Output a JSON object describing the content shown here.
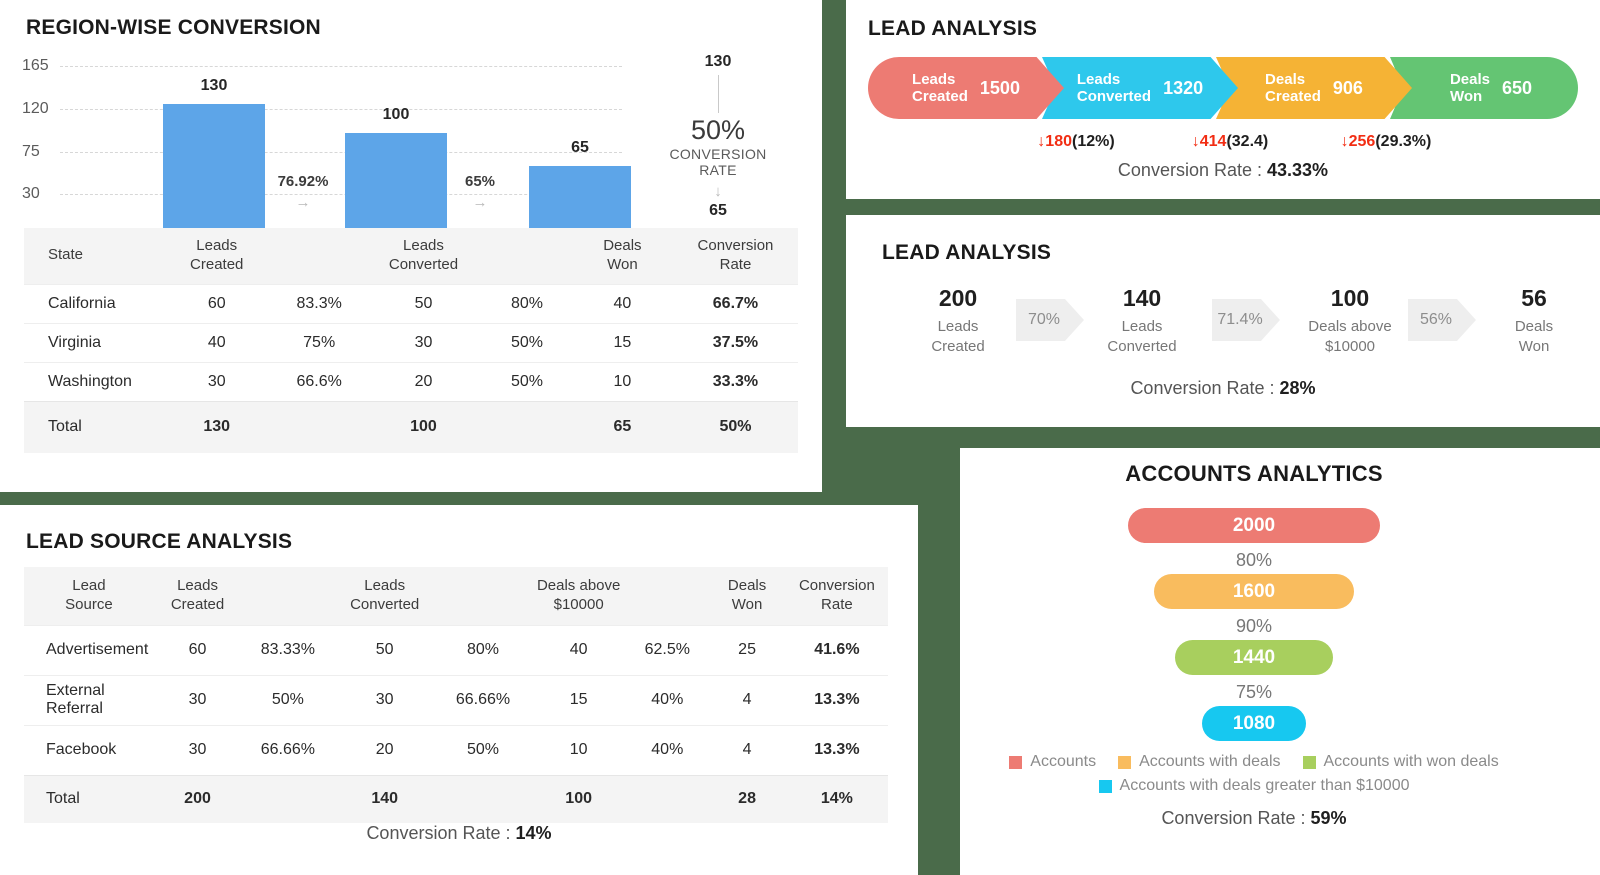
{
  "region_panel": {
    "title": "REGION-WISE CONVERSION",
    "conversion_annotation": {
      "top_value": "130",
      "rate": "50%",
      "rate_label": "CONVERSION RATE",
      "bottom_value": "65"
    },
    "table": {
      "headers": [
        "State",
        "Leads Created",
        "Leads Converted",
        "Deals Won",
        "Conversion Rate"
      ],
      "rows": [
        {
          "state": "California",
          "leads_created": "60",
          "pct1": "83.3%",
          "leads_converted": "50",
          "pct2": "80%",
          "deals_won": "40",
          "conversion_rate": "66.7%"
        },
        {
          "state": "Virginia",
          "leads_created": "40",
          "pct1": "75%",
          "leads_converted": "30",
          "pct2": "50%",
          "deals_won": "15",
          "conversion_rate": "37.5%"
        },
        {
          "state": "Washington",
          "leads_created": "30",
          "pct1": "66.6%",
          "leads_converted": "20",
          "pct2": "50%",
          "deals_won": "10",
          "conversion_rate": "33.3%"
        }
      ],
      "total": {
        "state": "Total",
        "leads_created": "130",
        "pct1": "",
        "leads_converted": "100",
        "pct2": "",
        "deals_won": "65",
        "conversion_rate": "50%"
      }
    }
  },
  "lead_analysis_1": {
    "title": "LEAD ANALYSIS",
    "stages": [
      {
        "label": "Leads\nCreated",
        "value": "1500",
        "color": "#ed7b73"
      },
      {
        "label": "Leads\nConverted",
        "value": "1320",
        "color": "#2ec8ec"
      },
      {
        "label": "Deals\nCreated",
        "value": "906",
        "color": "#f5b335"
      },
      {
        "label": "Deals\nWon",
        "value": "650",
        "color": "#64c573"
      }
    ],
    "drops": [
      {
        "arrow": "↓",
        "amount": "180",
        "pct": "(12%)"
      },
      {
        "arrow": "↓",
        "amount": "414",
        "pct": "(32.4)"
      },
      {
        "arrow": "↓",
        "amount": "256",
        "pct": "(29.3%)"
      }
    ],
    "conversion_label": "Conversion Rate : ",
    "conversion_value": "43.33%"
  },
  "lead_analysis_2": {
    "title": "LEAD ANALYSIS",
    "nodes": [
      {
        "value": "200",
        "label": "Leads\nCreated"
      },
      {
        "value": "140",
        "label": "Leads\nConverted"
      },
      {
        "value": "100",
        "label": "Deals above\n$10000"
      },
      {
        "value": "56",
        "label": "Deals\nWon"
      }
    ],
    "connectors": [
      "70%",
      "71.4%",
      "56%"
    ],
    "conversion_label": "Conversion Rate : ",
    "conversion_value": "28%"
  },
  "lead_source_panel": {
    "title": "LEAD SOURCE ANALYSIS",
    "table": {
      "headers": [
        "Lead Source",
        "Leads Created",
        "Leads Converted",
        "Deals above $10000",
        "Deals Won",
        "Conversion Rate"
      ],
      "rows": [
        {
          "source": "Advertisement",
          "leads_created": "60",
          "pct1": "83.33%",
          "leads_converted": "50",
          "pct2": "80%",
          "deals_above": "40",
          "pct3": "62.5%",
          "deals_won": "25",
          "conversion_rate": "41.6%"
        },
        {
          "source": "External Referral",
          "leads_created": "30",
          "pct1": "50%",
          "leads_converted": "30",
          "pct2": "66.66%",
          "deals_above": "15",
          "pct3": "40%",
          "deals_won": "4",
          "conversion_rate": "13.3%"
        },
        {
          "source": "Facebook",
          "leads_created": "30",
          "pct1": "66.66%",
          "leads_converted": "20",
          "pct2": "50%",
          "deals_above": "10",
          "pct3": "40%",
          "deals_won": "4",
          "conversion_rate": "13.3%"
        }
      ],
      "total": {
        "source": "Total",
        "leads_created": "200",
        "pct1": "",
        "leads_converted": "140",
        "pct2": "",
        "deals_above": "100",
        "pct3": "",
        "deals_won": "28",
        "conversion_rate": "14%"
      }
    },
    "conversion_label": "Conversion Rate : ",
    "conversion_value": "14%"
  },
  "accounts_panel": {
    "title": "ACCOUNTS ANALYTICS",
    "legend": [
      {
        "label": "Accounts",
        "color": "#ed7b73"
      },
      {
        "label": "Accounts with deals",
        "color": "#f9bc5e"
      },
      {
        "label": "Accounts with won deals",
        "color": "#a8cf5e"
      },
      {
        "label": "Accounts with deals greater than $10000",
        "color": "#17c8f0"
      }
    ],
    "conversion_label": "Conversion Rate : ",
    "conversion_value": "59%"
  },
  "chart_data": [
    {
      "type": "bar",
      "title": "REGION-WISE CONVERSION",
      "categories": [
        "Leads Created",
        "Leads Converted",
        "Deals Won"
      ],
      "values": [
        130,
        100,
        65
      ],
      "data_labels": [
        "130",
        "100",
        "65"
      ],
      "step_percentages": [
        "76.92%",
        "65%"
      ],
      "ytick_labels": [
        "30",
        "75",
        "120",
        "165"
      ],
      "ytick_values": [
        30,
        75,
        120,
        165
      ],
      "ylim": [
        0,
        165
      ],
      "grid": true,
      "legend": "none",
      "xlabel": "",
      "ylabel": ""
    },
    {
      "type": "bar",
      "title": "LEAD ANALYSIS",
      "subtitle": "funnel",
      "categories": [
        "Leads Created",
        "Leads Converted",
        "Deals Created",
        "Deals Won"
      ],
      "values": [
        1500,
        1320,
        906,
        650
      ],
      "drop_values": [
        180,
        414,
        256
      ],
      "drop_labels": [
        "(12%)",
        "(32.4)",
        "(29.3%)"
      ],
      "colors": [
        "#ed7b73",
        "#2ec8ec",
        "#f5b335",
        "#64c573"
      ],
      "annotation": "Conversion Rate : 43.33%",
      "legend": "none"
    },
    {
      "type": "bar",
      "title": "LEAD ANALYSIS",
      "subtitle": "steps",
      "categories": [
        "Leads Created",
        "Leads Converted",
        "Deals above $10000",
        "Deals Won"
      ],
      "values": [
        200,
        140,
        100,
        56
      ],
      "step_percentages": [
        "70%",
        "71.4%",
        "56%"
      ],
      "annotation": "Conversion Rate : 28%",
      "legend": "none"
    },
    {
      "type": "bar",
      "title": "ACCOUNTS ANALYTICS",
      "subtitle": "funnel",
      "categories": [
        "Accounts",
        "Accounts with deals",
        "Accounts with won deals",
        "Accounts with deals greater than $10000"
      ],
      "values": [
        2000,
        1600,
        1440,
        1080
      ],
      "step_percentages": [
        "80%",
        "90%",
        "75%"
      ],
      "colors": [
        "#ed7b73",
        "#f9bc5e",
        "#a8cf5e",
        "#17c8f0"
      ],
      "annotation": "Conversion Rate : 59%",
      "legend": "bottom"
    },
    {
      "type": "table",
      "title": "REGION-WISE CONVERSION",
      "columns": [
        "State",
        "Leads Created",
        "%",
        "Leads Converted",
        "%",
        "Deals Won",
        "Conversion Rate"
      ],
      "rows": [
        [
          "California",
          60,
          "83.3%",
          50,
          "80%",
          40,
          "66.7%"
        ],
        [
          "Virginia",
          40,
          "75%",
          30,
          "50%",
          15,
          "37.5%"
        ],
        [
          "Washington",
          30,
          "66.6%",
          20,
          "50%",
          10,
          "33.3%"
        ],
        [
          "Total",
          130,
          "",
          100,
          "",
          65,
          "50%"
        ]
      ]
    },
    {
      "type": "table",
      "title": "LEAD SOURCE ANALYSIS",
      "columns": [
        "Lead Source",
        "Leads Created",
        "%",
        "Leads Converted",
        "%",
        "Deals above $10000",
        "%",
        "Deals Won",
        "Conversion Rate"
      ],
      "rows": [
        [
          "Advertisement",
          60,
          "83.33%",
          50,
          "80%",
          40,
          "62.5%",
          25,
          "41.6%"
        ],
        [
          "External Referral",
          30,
          "50%",
          30,
          "66.66%",
          15,
          "40%",
          4,
          "13.3%"
        ],
        [
          "Facebook",
          30,
          "66.66%",
          20,
          "50%",
          10,
          "40%",
          4,
          "13.3%"
        ],
        [
          "Total",
          200,
          "",
          140,
          "",
          100,
          "",
          28,
          "14%"
        ]
      ],
      "annotation": "Conversion Rate : 14%"
    }
  ]
}
